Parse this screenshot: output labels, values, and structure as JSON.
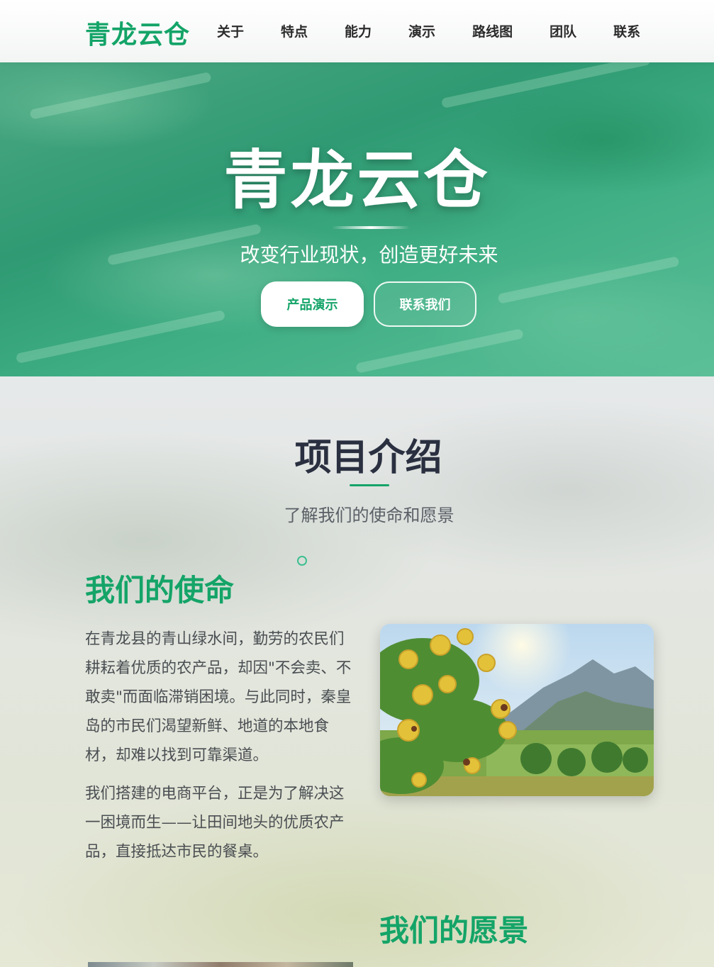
{
  "nav": {
    "brand": "青龙云仓",
    "items": [
      "关于",
      "特点",
      "能力",
      "演示",
      "路线图",
      "团队",
      "联系"
    ]
  },
  "hero": {
    "title": "青龙云仓",
    "subtitle": "改变行业现状，创造更好未来",
    "primary_button": "产品演示",
    "secondary_button": "联系我们"
  },
  "intro": {
    "title": "项目介绍",
    "subtitle": "了解我们的使命和愿景",
    "mission": {
      "heading": "我们的使命",
      "paragraph1": "在青龙县的青山绿水间，勤劳的农民们耕耘着优质的农产品，却因\"不会卖、不敢卖\"而面临滞销困境。与此同时，秦皇岛的市民们渴望新鲜、地道的本地食材，却难以找到可靠渠道。",
      "paragraph2": "我们搭建的电商平台，正是为了解决这一困境而生——让田间地头的优质农产品，直接抵达市民的餐桌。"
    },
    "vision": {
      "heading": "我们的愿景"
    }
  },
  "colors": {
    "accent": "#14a468",
    "heading_dark": "#2a3040",
    "body_text": "#4a4e52"
  }
}
